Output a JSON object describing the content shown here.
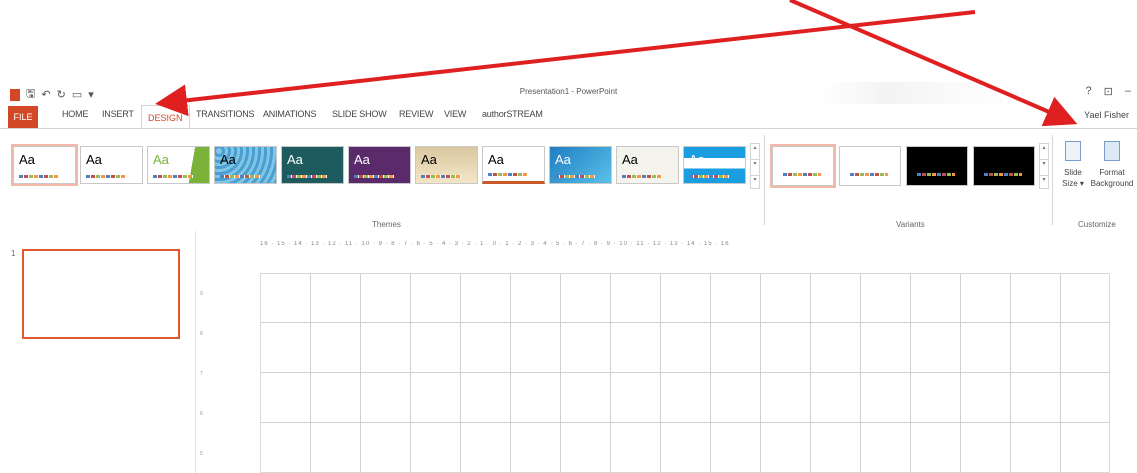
{
  "window": {
    "title": "Presentation1 - PowerPoint",
    "user": "Yael Fisher",
    "controls": [
      "?",
      "⊡",
      "–"
    ]
  },
  "tabs": [
    "FILE",
    "HOME",
    "INSERT",
    "DESIGN",
    "TRANSITIONS",
    "ANIMATIONS",
    "SLIDE SHOW",
    "REVIEW",
    "VIEW",
    "authorSTREAM"
  ],
  "active_tab": "DESIGN",
  "ribbon": {
    "themes_label": "Themes",
    "variants_label": "Variants",
    "customize_label": "Customize",
    "theme_sample": "Aa",
    "slide_size": {
      "line1": "Slide",
      "line2": "Size ▾"
    },
    "format_background": {
      "line1": "Format",
      "line2": "Background"
    }
  },
  "ruler": "16 · 15 · 14 · 13 · 12 · 11 · 10 · 9 · 8 · 7 · 6 · 5 · 4 · 3 · 2 · 1 · 0 · 1 · 2 · 3 · 4 · 5 · 6 · 7 · 8 · 9 · 10 · 11 · 12 · 13 · 14 · 15 · 16",
  "vertical_ruler": [
    "9",
    "8",
    "7",
    "6",
    "5"
  ],
  "slides": [
    {
      "number": "1"
    }
  ],
  "colors": {
    "accent": "#d24726",
    "annotation_arrow": "#e02020",
    "thumb_border": "#e0582c"
  }
}
